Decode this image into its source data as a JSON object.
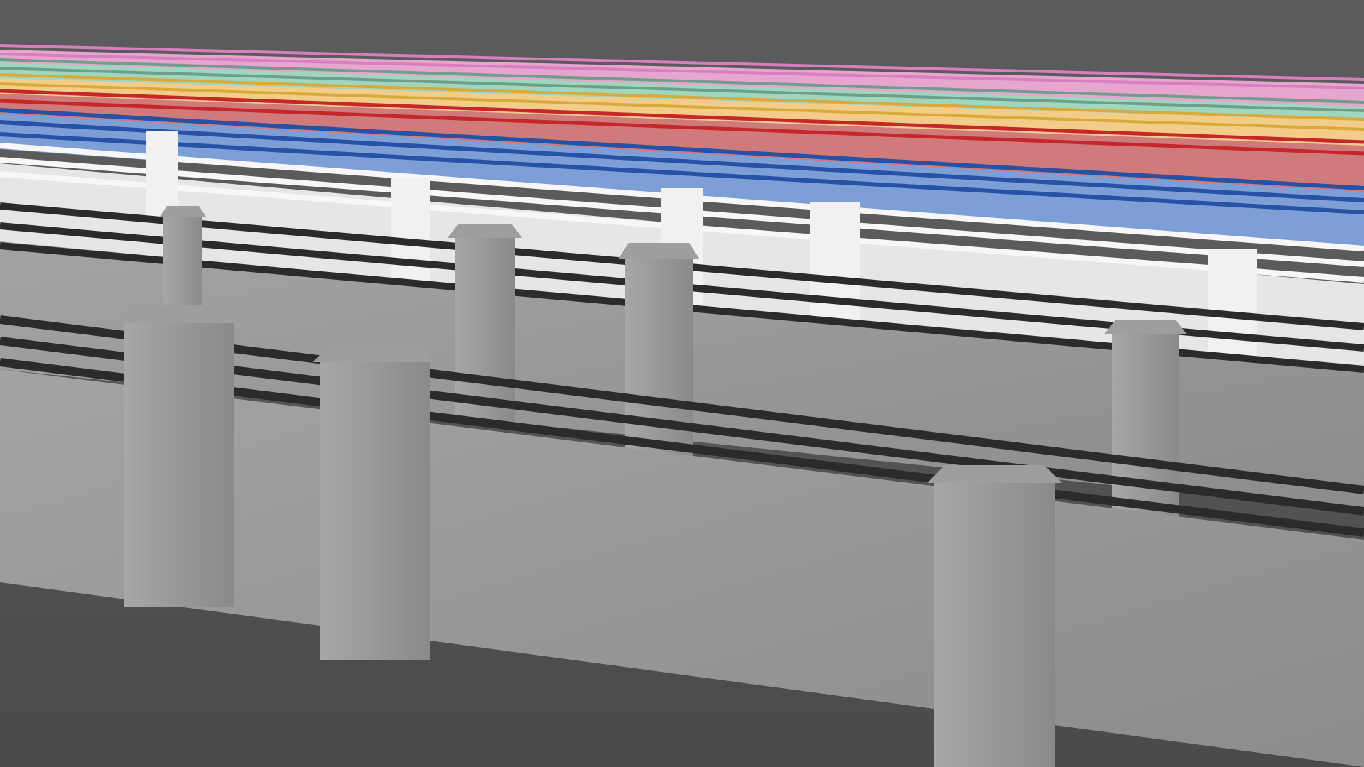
{
  "scene": {
    "background": "#5b5b5b",
    "ground": "#4a4a4a",
    "concrete": "#9a9a9a",
    "rail": "#2b2b2b",
    "rows": [
      {
        "name": "pink",
        "color": "#e6a6cf",
        "rail": "#d77fbf"
      },
      {
        "name": "mint",
        "color": "#9fd6bd",
        "rail": "#6f9f8a"
      },
      {
        "name": "yellow",
        "color": "#f3cc8a",
        "rail": "#d9a93a"
      },
      {
        "name": "salmon",
        "color": "#cf7b7b",
        "rail": "#c5272a"
      },
      {
        "name": "blue",
        "color": "#7d9fd6",
        "rail": "#2552a6"
      },
      {
        "name": "white",
        "color": "#e6e6e6",
        "rail": "#f7f7f7"
      },
      {
        "name": "gray",
        "color": "#8e8e8e",
        "rail": "#262626"
      }
    ]
  }
}
